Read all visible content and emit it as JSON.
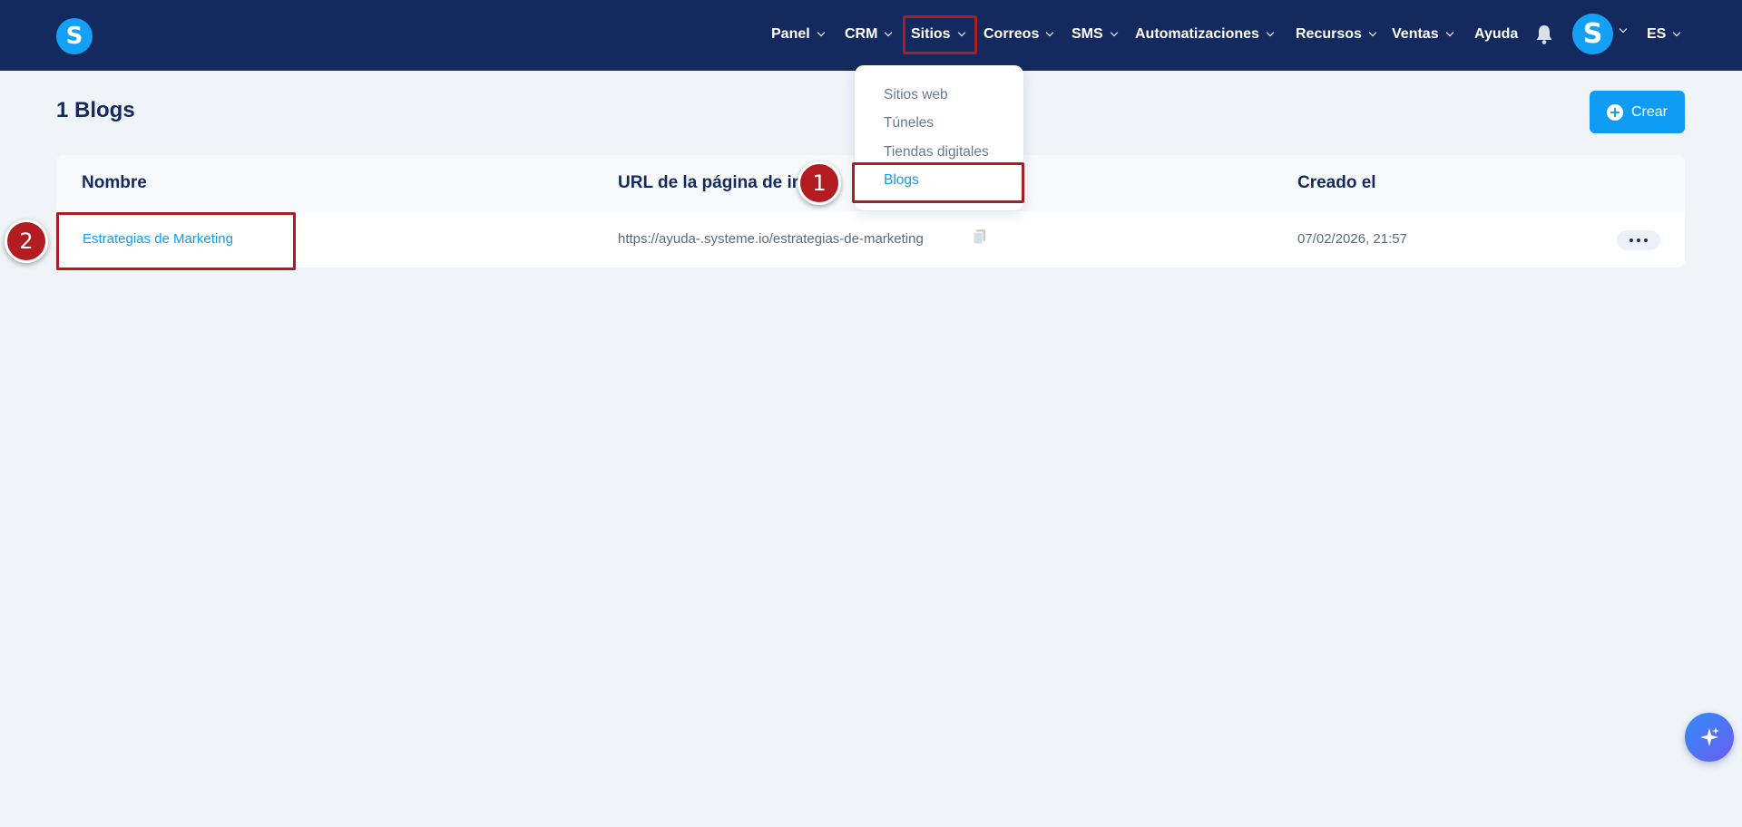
{
  "header": {
    "logo_letter": "S",
    "nav": [
      {
        "label": "Panel"
      },
      {
        "label": "CRM"
      },
      {
        "label": "Sitios"
      },
      {
        "label": "Correos"
      },
      {
        "label": "SMS"
      },
      {
        "label": "Automatizaciones"
      },
      {
        "label": "Recursos"
      },
      {
        "label": "Ventas"
      },
      {
        "label": "Ayuda"
      }
    ],
    "avatar_letter": "S",
    "language": "ES"
  },
  "sitios_menu": {
    "items": [
      "Sitios web",
      "Túneles",
      "Tiendas digitales",
      "Blogs"
    ],
    "active": "Blogs"
  },
  "page": {
    "title": "1 Blogs",
    "create_label": "Crear"
  },
  "table": {
    "columns": [
      "Nombre",
      "URL de la página de inicio",
      "Creado el"
    ],
    "rows": [
      {
        "name": "Estrategias de Marketing",
        "url": "https://ayuda-.systeme.io/estrategias-de-marketing",
        "created": "07/02/2026, 21:57"
      }
    ]
  },
  "steps": [
    "1",
    "2"
  ],
  "colors": {
    "nav_bg": "#142a5e",
    "page_bg": "#f0f3f8",
    "accent": "#0f9cf5",
    "highlight": "#a81e22"
  }
}
